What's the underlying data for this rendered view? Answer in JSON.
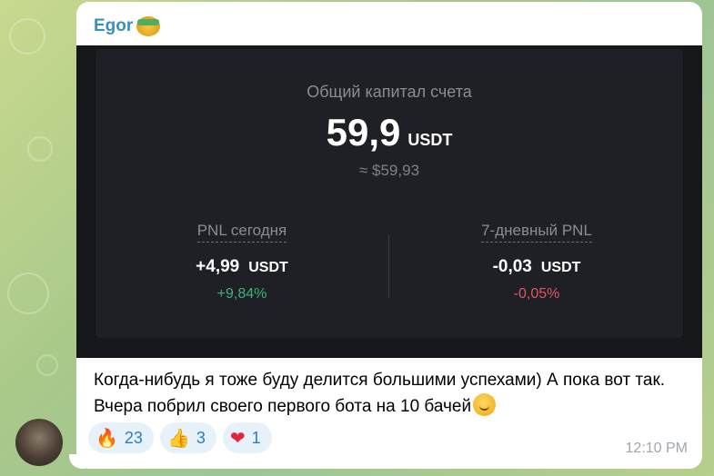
{
  "message": {
    "sender": "Egor",
    "text": "Когда-нибудь я тоже буду делится большими успехами) А пока вот так. Вчера побрил своего первого бота на 10 бачей",
    "time": "12:10 PM"
  },
  "screenshot": {
    "total_capital_label": "Общий капитал счета",
    "total_capital_value": "59,9",
    "total_capital_unit": "USDT",
    "total_capital_usd": "≈ $59,93",
    "pnl_today": {
      "label": "PNL сегодня",
      "value": "+4,99",
      "unit": "USDT",
      "percent": "+9,84%"
    },
    "pnl_7d": {
      "label": "7-дневный PNL",
      "value": "-0,03",
      "unit": "USDT",
      "percent": "-0,05%"
    }
  },
  "reactions": [
    {
      "icon": "fire-icon",
      "glyph": "🔥",
      "count": "23"
    },
    {
      "icon": "thumbs-up-icon",
      "glyph": "👍",
      "count": "3"
    },
    {
      "icon": "heart-icon",
      "glyph": "❤",
      "count": "1"
    }
  ],
  "colors": {
    "sender_name": "#3b8fbf",
    "positive": "#3fb376",
    "negative": "#e25563",
    "reaction_bg": "#e6f1fa",
    "reaction_count": "#2c7ec1"
  }
}
